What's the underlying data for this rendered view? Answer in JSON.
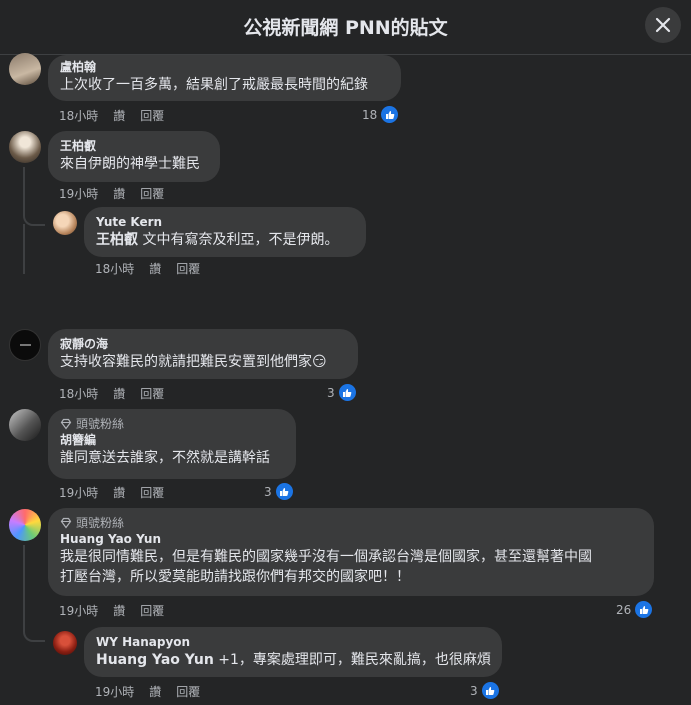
{
  "header": {
    "title": "公視新聞網 PNN的貼文"
  },
  "comments": [
    {
      "name": "盧柏翰",
      "text": "上次收了一百多萬，結果創了戒嚴最長時間的紀錄",
      "time": "18小時",
      "like": "讚",
      "reply": "回覆",
      "reactions": "18"
    },
    {
      "name": "王柏叡",
      "text": "來自伊朗的神學士難民",
      "time": "19小時",
      "like": "讚",
      "reply": "回覆",
      "replies": [
        {
          "name": "Yute Kern",
          "mention": "王柏叡",
          "text": " 文中有寫奈及利亞，不是伊朗。",
          "time": "18小時",
          "like": "讚",
          "reply": "回覆"
        }
      ]
    },
    {
      "name": "寂靜の海",
      "text": "支持收容難民的就請把難民安置到他們家",
      "emoji": "😏",
      "time": "18小時",
      "like": "讚",
      "reply": "回覆",
      "reactions": "3"
    },
    {
      "badge": "頭號粉絲",
      "name": "胡簪編",
      "text": "誰同意送去誰家，不然就是講幹話",
      "time": "19小時",
      "like": "讚",
      "reply": "回覆",
      "reactions": "3"
    },
    {
      "badge": "頭號粉絲",
      "name": "Huang Yao Yun",
      "text_line1": "我是很同情難民，但是有難民的國家幾乎沒有一個承認台灣是個國家，甚至還幫著中國",
      "text_line2": "打壓台灣，所以愛莫能助請找跟你們有邦交的國家吧！！",
      "time": "19小時",
      "like": "讚",
      "reply": "回覆",
      "reactions": "26",
      "replies": [
        {
          "name": "WY Hanapyon",
          "mention": "Huang Yao Yun",
          "text": " +1，專案處理即可，難民來亂搞，也很麻煩",
          "time": "19小時",
          "like": "讚",
          "reply": "回覆",
          "reactions": "3"
        }
      ]
    }
  ],
  "colors": {
    "background": "#242526",
    "bubble": "#3a3b3c",
    "like_blue": "#1b74e4",
    "meta_text": "#b0b3b8"
  }
}
